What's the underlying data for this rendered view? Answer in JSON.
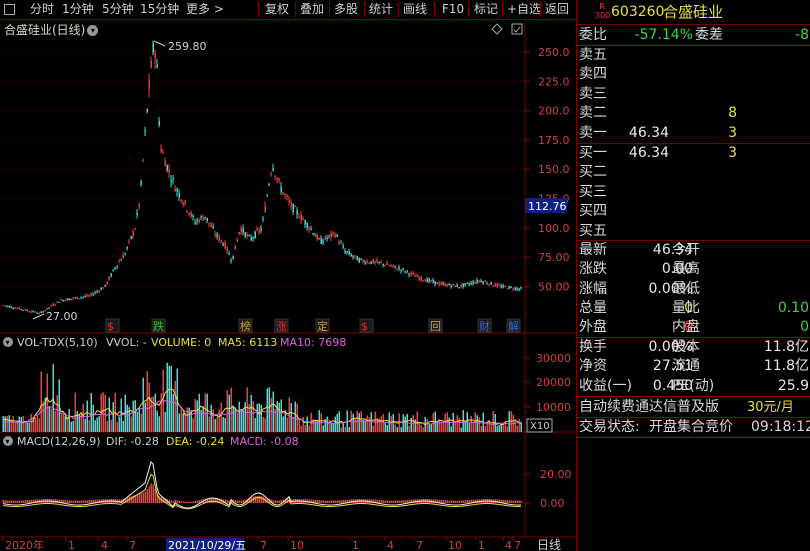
{
  "toolbar": {
    "items": [
      "分时",
      "1分钟",
      "5分钟",
      "15分钟",
      "更多 >",
      "复权",
      "叠加",
      "多股",
      "统计",
      "画线",
      "F10",
      "标记",
      "+自选",
      "返回"
    ]
  },
  "chart": {
    "title": "合盛硅业(日线)",
    "main_y_ticks": [
      "250.0",
      "225.0",
      "200.0",
      "175.0",
      "150.0",
      "125.0",
      "100.0",
      "75.00",
      "50.00"
    ],
    "current_price": "112.76",
    "high_label": "259.80",
    "low_label": "27.00",
    "events": [
      {
        "text": "$",
        "color": "#e03030"
      },
      {
        "text": "跌",
        "color": "#30c030"
      },
      {
        "text": "榜",
        "color": "#d0a040"
      },
      {
        "text": "涨",
        "color": "#e03030"
      },
      {
        "text": "定",
        "color": "#d0a040"
      },
      {
        "text": "$",
        "color": "#e03030"
      },
      {
        "text": "回",
        "color": "#d0a040"
      },
      {
        "text": "财",
        "color": "#3070e0"
      },
      {
        "text": "解",
        "color": "#3070e0"
      }
    ],
    "vol_header": {
      "name": "VOL-TDX(5,10)",
      "vvol": "VVOL: -",
      "volume": "VOLUME: 0",
      "ma5": "MA5: 6113",
      "ma10": "MA10: 7698"
    },
    "vol_y_ticks": [
      "30000",
      "20000",
      "10000"
    ],
    "vol_unit": "X10",
    "macd_header": {
      "name": "MACD(12,26,9)",
      "dif": "DIF: -0.28",
      "dea": "DEA: -0.24",
      "macd": "MACD: -0.08"
    },
    "macd_y_ticks": [
      "20.00",
      "0.00"
    ],
    "x_axis": {
      "labels": [
        "2020年",
        "1",
        "4",
        "7",
        "1",
        "7",
        "10",
        "1",
        "4",
        "7",
        "10",
        "1",
        "4",
        "7"
      ],
      "cursor_date": "2021/10/29/五",
      "period": "日线"
    }
  },
  "quote": {
    "code": "603260",
    "name": "合盛硅业",
    "badge_top": "R",
    "badge_bottom": "300",
    "weibi_label": "委比",
    "weibi": "-57.14%",
    "weicha_label": "委差",
    "weicha": "-8",
    "sell": [
      {
        "label": "卖五",
        "price": "",
        "vol": ""
      },
      {
        "label": "卖四",
        "price": "",
        "vol": ""
      },
      {
        "label": "卖三",
        "price": "",
        "vol": ""
      },
      {
        "label": "卖二",
        "price": "",
        "vol": "8"
      },
      {
        "label": "卖一",
        "price": "46.34",
        "vol": "3"
      }
    ],
    "buy": [
      {
        "label": "买一",
        "price": "46.34",
        "vol": "3"
      },
      {
        "label": "买二",
        "price": "",
        "vol": ""
      },
      {
        "label": "买三",
        "price": "",
        "vol": ""
      },
      {
        "label": "买四",
        "price": "",
        "vol": ""
      },
      {
        "label": "买五",
        "price": "",
        "vol": ""
      }
    ],
    "stats": [
      {
        "l1": "最新",
        "v1": "46.34",
        "c1": "#e8e8e8",
        "l2": "今开",
        "v2": "",
        "c2": "#e8e8e8"
      },
      {
        "l1": "涨跌",
        "v1": "0.00",
        "c1": "#e8e8e8",
        "l2": "最高",
        "v2": "",
        "c2": "#e8e8e8"
      },
      {
        "l1": "涨幅",
        "v1": "0.00%",
        "c1": "#e8e8e8",
        "l2": "最低",
        "v2": "",
        "c2": "#e8e8e8"
      },
      {
        "l1": "总量",
        "v1": "0",
        "c1": "#e8e040",
        "l2": "量比",
        "v2": "0.10",
        "c2": "#40d040"
      },
      {
        "l1": "外盘",
        "v1": "0",
        "c1": "#ff4040",
        "l2": "内盘",
        "v2": "0",
        "c2": "#40d040"
      }
    ],
    "stats2": [
      {
        "l1": "换手",
        "v1": "0.00%",
        "l2": "股本",
        "v2": "11.8亿"
      },
      {
        "l1": "净资",
        "v1": "27.51",
        "l2": "流通",
        "v2": "11.8亿"
      },
      {
        "l1": "收益(一)",
        "v1": "0.450",
        "l2": "PE(动)",
        "v2": "25.9"
      }
    ],
    "promo": {
      "text": "自动续费通达信普及版",
      "price": "30元/月"
    },
    "status": {
      "label": "交易状态:",
      "value": "开盘集合竞价",
      "time": "09:18:12"
    }
  }
}
